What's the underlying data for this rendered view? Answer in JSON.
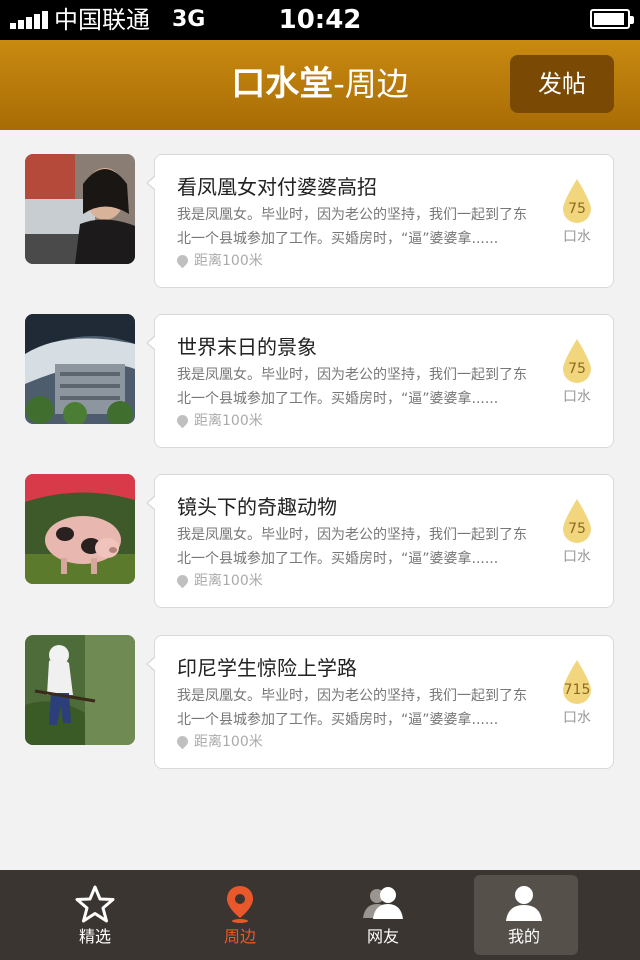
{
  "status_bar": {
    "carrier": "中国联通",
    "network": "3G",
    "time": "10:42"
  },
  "nav": {
    "brand": "口水堂",
    "subtitle": "-周边",
    "post_button": "发帖"
  },
  "feed": {
    "items": [
      {
        "title": "看凤凰女对付婆婆高招",
        "desc": "我是凤凰女。毕业时，因为老公的坚持，我们一起到了东北一个县城参加了工作。买婚房时，“逼”婆婆拿......",
        "distance": "距离100米",
        "count": "75",
        "count_label": "口水"
      },
      {
        "title": "世界末日的景象",
        "desc": "我是凤凰女。毕业时，因为老公的坚持，我们一起到了东北一个县城参加了工作。买婚房时，“逼”婆婆拿......",
        "distance": "距离100米",
        "count": "75",
        "count_label": "口水"
      },
      {
        "title": "镜头下的奇趣动物",
        "desc": "我是凤凰女。毕业时，因为老公的坚持，我们一起到了东北一个县城参加了工作。买婚房时，“逼”婆婆拿......",
        "distance": "距离100米",
        "count": "75",
        "count_label": "口水"
      },
      {
        "title": "印尼学生惊险上学路",
        "desc": "我是凤凰女。毕业时，因为老公的坚持，我们一起到了东北一个县城参加了工作。买婚房时，“逼”婆婆拿......",
        "distance": "距离100米",
        "count": "715",
        "count_label": "口水"
      }
    ]
  },
  "tabs": [
    {
      "label": "精选",
      "icon": "star-icon"
    },
    {
      "label": "周边",
      "icon": "location-pin-icon"
    },
    {
      "label": "网友",
      "icon": "friends-icon"
    },
    {
      "label": "我的",
      "icon": "user-icon"
    }
  ],
  "colors": {
    "nav": "#b87a0a",
    "accent": "#e8582a",
    "tabbar": "#3a3530",
    "drop": "#f2d67e"
  }
}
